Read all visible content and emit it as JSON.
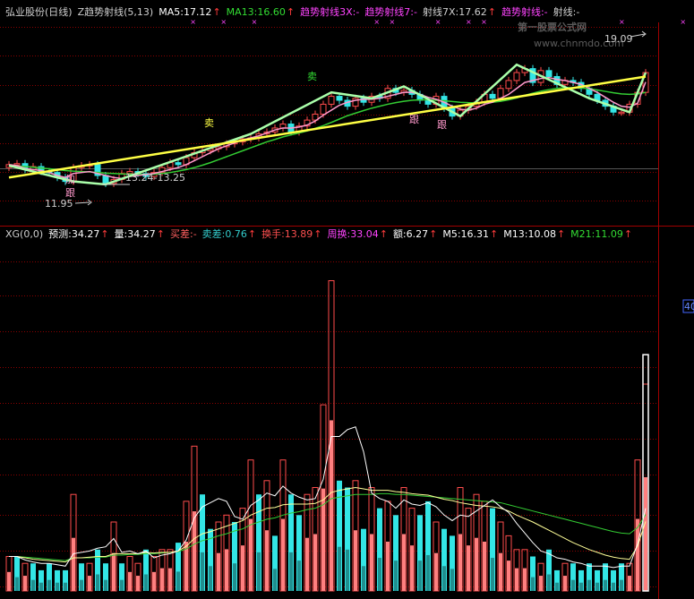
{
  "price_legend": [
    {
      "text": "弘业股份(日线)",
      "color": "#cfcfcf"
    },
    {
      "text": "Z趋势射线(5,13)",
      "color": "#cfcfcf"
    },
    {
      "text": "MA5:17.12",
      "color": "#ffffff"
    },
    {
      "text": "↑",
      "color": "#ff3b3b"
    },
    {
      "text": "MA13:16.60",
      "color": "#33dd33"
    },
    {
      "text": "↑",
      "color": "#ff3b3b"
    },
    {
      "text": "趋势射线3X:-",
      "color": "#ff44ff"
    },
    {
      "text": "趋势射线7:-",
      "color": "#ff44ff"
    },
    {
      "text": "射线7X:17.62",
      "color": "#cfcfcf"
    },
    {
      "text": "↑",
      "color": "#ff3b3b"
    },
    {
      "text": "趋势射线:-",
      "color": "#ff44ff"
    },
    {
      "text": "射线:-",
      "color": "#cfcfcf"
    }
  ],
  "vol_legend": [
    {
      "text": "XG(0,0)",
      "color": "#cfcfcf"
    },
    {
      "text": "预测:34.27",
      "color": "#ffffff"
    },
    {
      "text": "↑",
      "color": "#ff3b3b"
    },
    {
      "text": "量:34.27",
      "color": "#ffffff"
    },
    {
      "text": "↑",
      "color": "#ff3b3b"
    },
    {
      "text": "买差:-",
      "color": "#ff6060"
    },
    {
      "text": "卖差:0.76",
      "color": "#33cccc"
    },
    {
      "text": "↑",
      "color": "#ff3b3b"
    },
    {
      "text": "换手:13.89",
      "color": "#ff5050"
    },
    {
      "text": "↑",
      "color": "#ff3b3b"
    },
    {
      "text": "周换:33.04",
      "color": "#ff44ff"
    },
    {
      "text": "↑",
      "color": "#ff3b3b"
    },
    {
      "text": "额:6.27",
      "color": "#ffffff"
    },
    {
      "text": "↑",
      "color": "#ff3b3b"
    },
    {
      "text": "M5:16.31",
      "color": "#ffffff"
    },
    {
      "text": "↑",
      "color": "#ff3b3b"
    },
    {
      "text": "M13:10.08",
      "color": "#ffffff"
    },
    {
      "text": "↑",
      "color": "#ff3b3b"
    },
    {
      "text": "M21:11.09",
      "color": "#33dd33"
    },
    {
      "text": "↑",
      "color": "#ff3b3b"
    }
  ],
  "annotations": {
    "sell_1": "卖",
    "sell_2": "卖",
    "add": "加",
    "follow_1": "跟",
    "follow_2": "跟",
    "follow_3": "跟",
    "low_label": "11.95",
    "range_label": "13.24-13.25",
    "high_label": "19.09"
  },
  "watermark": {
    "line1": "第一股票公式网",
    "line2": "www.chnmdo.com"
  },
  "right_axis_label": "40",
  "colors": {
    "background": "#000000",
    "up": "#ff4c4c",
    "down": "#33e5e5",
    "vol_up": "#ff7f7f",
    "vol_down": "#33e5e5",
    "ma5": "#ffffff",
    "ma13": "#33cc33",
    "trend": "#ffff44",
    "zigzag": "#aaffaa",
    "pink": "#ff99cc",
    "grid": "#8b0000"
  },
  "chart_data": [
    {
      "type": "candlestick",
      "title": "弘业股份(日线)",
      "ylim": [
        10.5,
        20.0
      ],
      "n_bars": 80,
      "close": [
        12.95,
        13.0,
        12.7,
        12.85,
        12.6,
        12.55,
        12.3,
        12.1,
        12.8,
        12.9,
        12.95,
        12.4,
        12.0,
        12.2,
        12.5,
        12.6,
        12.5,
        12.35,
        12.55,
        12.8,
        13.05,
        12.95,
        13.3,
        13.55,
        13.65,
        13.75,
        13.85,
        14.0,
        14.1,
        14.25,
        14.3,
        14.5,
        14.6,
        14.8,
        15.0,
        14.6,
        14.9,
        15.2,
        15.5,
        16.0,
        16.4,
        16.2,
        15.9,
        16.3,
        16.1,
        16.4,
        16.3,
        16.8,
        16.6,
        16.7,
        16.5,
        16.2,
        16.0,
        16.4,
        15.8,
        15.4,
        15.7,
        15.9,
        16.1,
        16.5,
        16.3,
        16.8,
        17.2,
        17.6,
        17.8,
        17.1,
        17.7,
        17.4,
        17.0,
        17.2,
        17.1,
        16.8,
        16.5,
        16.2,
        15.9,
        15.6,
        15.6,
        16.0,
        16.6,
        17.6
      ],
      "ma5": [
        12.95,
        12.9,
        12.75,
        12.7,
        12.65,
        12.55,
        12.4,
        12.3,
        12.5,
        12.55,
        12.6,
        12.5,
        12.4,
        12.3,
        12.25,
        12.35,
        12.4,
        12.45,
        12.5,
        12.6,
        12.7,
        12.8,
        12.95,
        13.15,
        13.35,
        13.55,
        13.75,
        13.9,
        14.05,
        14.2,
        14.3,
        14.4,
        14.55,
        14.7,
        14.8,
        14.8,
        14.85,
        14.95,
        15.15,
        15.45,
        15.7,
        15.95,
        16.1,
        16.2,
        16.25,
        16.25,
        16.3,
        16.4,
        16.5,
        16.6,
        16.6,
        16.5,
        16.35,
        16.25,
        16.1,
        15.9,
        15.75,
        15.7,
        15.8,
        16.0,
        16.1,
        16.3,
        16.5,
        16.8,
        17.1,
        17.2,
        17.3,
        17.35,
        17.25,
        17.2,
        17.1,
        17.0,
        16.8,
        16.6,
        16.35,
        16.1,
        15.9,
        15.85,
        16.05,
        17.12
      ],
      "ma13": [
        12.9,
        12.88,
        12.85,
        12.82,
        12.78,
        12.74,
        12.7,
        12.65,
        12.62,
        12.6,
        12.58,
        12.55,
        12.52,
        12.5,
        12.48,
        12.47,
        12.46,
        12.46,
        12.47,
        12.5,
        12.55,
        12.62,
        12.7,
        12.8,
        12.92,
        13.05,
        13.2,
        13.35,
        13.5,
        13.65,
        13.8,
        13.95,
        14.1,
        14.22,
        14.35,
        14.45,
        14.55,
        14.65,
        14.78,
        14.92,
        15.08,
        15.25,
        15.42,
        15.55,
        15.68,
        15.8,
        15.9,
        16.0,
        16.08,
        16.15,
        16.2,
        16.22,
        16.22,
        16.2,
        16.18,
        16.14,
        16.1,
        16.08,
        16.07,
        16.08,
        16.1,
        16.15,
        16.22,
        16.32,
        16.45,
        16.56,
        16.66,
        16.74,
        16.8,
        16.84,
        16.84,
        16.82,
        16.78,
        16.72,
        16.65,
        16.58,
        16.52,
        16.5,
        16.52,
        16.6
      ],
      "trendline": {
        "start": 12.3,
        "end": 17.4
      },
      "annotated_low": 11.95,
      "annotated_high": 19.09
    },
    {
      "type": "bar",
      "title": "XG(0,0)",
      "ylim": [
        0,
        50
      ],
      "n_bars": 80,
      "values": [
        5,
        5,
        4,
        4,
        3,
        4,
        3,
        3,
        14,
        4,
        4,
        6,
        4,
        10,
        4,
        5,
        4,
        6,
        5,
        6,
        6,
        7,
        13,
        21,
        14,
        9,
        10,
        11,
        10,
        12,
        19,
        14,
        16,
        8,
        19,
        14,
        11,
        14,
        15,
        27,
        45,
        16,
        15,
        16,
        9,
        15,
        12,
        13,
        11,
        15,
        12,
        11,
        13,
        10,
        9,
        8,
        15,
        12,
        14,
        13,
        12,
        10,
        8,
        6,
        6,
        5,
        4,
        6,
        3,
        4,
        4,
        3,
        4,
        3,
        4,
        3,
        4,
        4,
        19,
        30
      ],
      "direction": [
        1,
        0,
        1,
        0,
        0,
        0,
        0,
        0,
        1,
        0,
        1,
        0,
        0,
        1,
        0,
        1,
        1,
        0,
        1,
        1,
        1,
        0,
        1,
        1,
        0,
        0,
        1,
        1,
        0,
        1,
        1,
        0,
        1,
        0,
        1,
        0,
        0,
        1,
        1,
        1,
        1,
        0,
        0,
        1,
        0,
        1,
        0,
        1,
        0,
        1,
        1,
        0,
        0,
        1,
        0,
        0,
        1,
        1,
        1,
        1,
        0,
        1,
        1,
        1,
        1,
        0,
        1,
        0,
        0,
        1,
        0,
        0,
        0,
        0,
        0,
        0,
        0,
        1,
        1,
        1
      ],
      "m5": [
        5,
        5,
        4.5,
        4.2,
        4,
        4,
        3.8,
        3.6,
        5.4,
        5.6,
        5.8,
        6.2,
        6.4,
        7.6,
        5.6,
        5.8,
        5.4,
        5.8,
        4.8,
        5.2,
        5.4,
        5.8,
        7.4,
        10.6,
        12.2,
        12.8,
        13.4,
        13,
        10.8,
        10.4,
        12.4,
        13.2,
        14.2,
        13.8,
        15.2,
        14.2,
        13.6,
        13.2,
        13.4,
        16.2,
        22.4,
        22.4,
        23.4,
        23.8,
        20.2,
        14.2,
        13.4,
        13,
        12,
        13.2,
        12.6,
        12.4,
        12.8,
        12.2,
        11,
        10.2,
        11,
        10.8,
        11.6,
        12.4,
        13.2,
        12.2,
        11.4,
        9.8,
        8.4,
        7,
        5.8,
        5.4,
        4.8,
        4.6,
        4.2,
        4,
        3.6,
        3.6,
        3.6,
        3.4,
        3.6,
        3.6,
        6.8,
        12
      ],
      "m13": [
        5,
        5,
        4.8,
        4.6,
        4.5,
        4.4,
        4.3,
        4.2,
        4.8,
        4.8,
        4.9,
        5,
        5,
        5.4,
        5.4,
        5.4,
        5.4,
        5.6,
        5.5,
        5.6,
        5.6,
        5.8,
        6.5,
        7.6,
        8.3,
        8.6,
        9,
        9.4,
        9.8,
        10.2,
        11,
        11.5,
        12,
        12.1,
        12.5,
        12.6,
        12.6,
        12.6,
        12.7,
        13.2,
        14.3,
        14.6,
        14.8,
        15,
        14.8,
        14.6,
        14.6,
        14.6,
        14.4,
        14.3,
        14.1,
        14,
        13.9,
        13.6,
        13.3,
        13.1,
        12.8,
        12.6,
        12.4,
        12.3,
        12.2,
        12,
        11.6,
        11,
        10.5,
        10,
        9.4,
        8.8,
        8.2,
        7.6,
        7,
        6.5,
        6,
        5.6,
        5.2,
        4.9,
        4.7,
        4.6,
        6.5,
        10.08
      ],
      "m21": [
        5,
        5,
        4.9,
        4.8,
        4.7,
        4.6,
        4.5,
        4.4,
        4.8,
        4.8,
        4.8,
        4.9,
        4.9,
        5.2,
        5.2,
        5.3,
        5.3,
        5.4,
        5.4,
        5.5,
        5.6,
        5.7,
        6.1,
        6.8,
        7.3,
        7.6,
        8,
        8.3,
        8.7,
        9,
        9.6,
        10,
        10.4,
        10.6,
        11,
        11.3,
        11.5,
        11.8,
        12,
        12.5,
        13.4,
        13.6,
        13.8,
        14,
        14,
        14,
        14.1,
        14.1,
        14,
        14,
        13.9,
        13.8,
        13.7,
        13.6,
        13.5,
        13.4,
        13.3,
        13.2,
        13.1,
        13,
        12.9,
        12.8,
        12.5,
        12.2,
        11.9,
        11.6,
        11.3,
        11,
        10.7,
        10.4,
        10.1,
        9.8,
        9.5,
        9.2,
        8.9,
        8.6,
        8.4,
        8.3,
        9.2,
        11.09
      ]
    }
  ]
}
